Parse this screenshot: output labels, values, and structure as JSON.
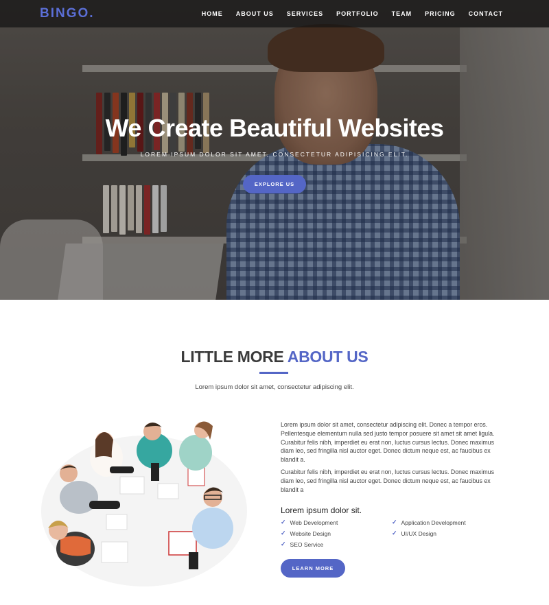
{
  "brand": {
    "logo": "BINGO.",
    "accent_color": "#5466c6"
  },
  "nav": {
    "items": [
      "HOME",
      "ABOUT US",
      "SERVICES",
      "PORTFOLIO",
      "TEAM",
      "PRICING",
      "CONTACT"
    ]
  },
  "hero": {
    "title": "We Create Beautiful Websites",
    "subtitle": "LOREM IPSUM DOLOR SIT AMET, CONSECTETUR ADIPISICING ELIT.",
    "button": "EXPLORE US"
  },
  "about": {
    "title_plain": "LITTLE MORE ",
    "title_accent": "ABOUT US",
    "subtitle": "Lorem ipsum dolor sit amet, consectetur adipiscing elit.",
    "paragraph1": "Lorem ipsum dolor sit amet, consectetur adipiscing elit. Donec a tempor eros. Pellentesque elementum nulla sed justo tempor posuere sit amet sit amet ligula. Curabitur felis nibh, imperdiet eu erat non, luctus cursus lectus. Donec maximus diam leo, sed fringilla nisl auctor eget. Donec dictum neque est, ac faucibus ex blandit a.",
    "paragraph2": "Curabitur felis nibh, imperdiet eu erat non, luctus cursus lectus. Donec maximus diam leo, sed fringilla nisl auctor eget. Donec dictum neque est, ac faucibus ex blandit a",
    "list_title": "Lorem ipsum dolor sit.",
    "features": [
      "Web Development",
      "Application Development",
      "Website Design",
      "UI/UX Design",
      "SEO Service"
    ],
    "check_icon": "check-icon",
    "button": "LEARN MORE"
  }
}
